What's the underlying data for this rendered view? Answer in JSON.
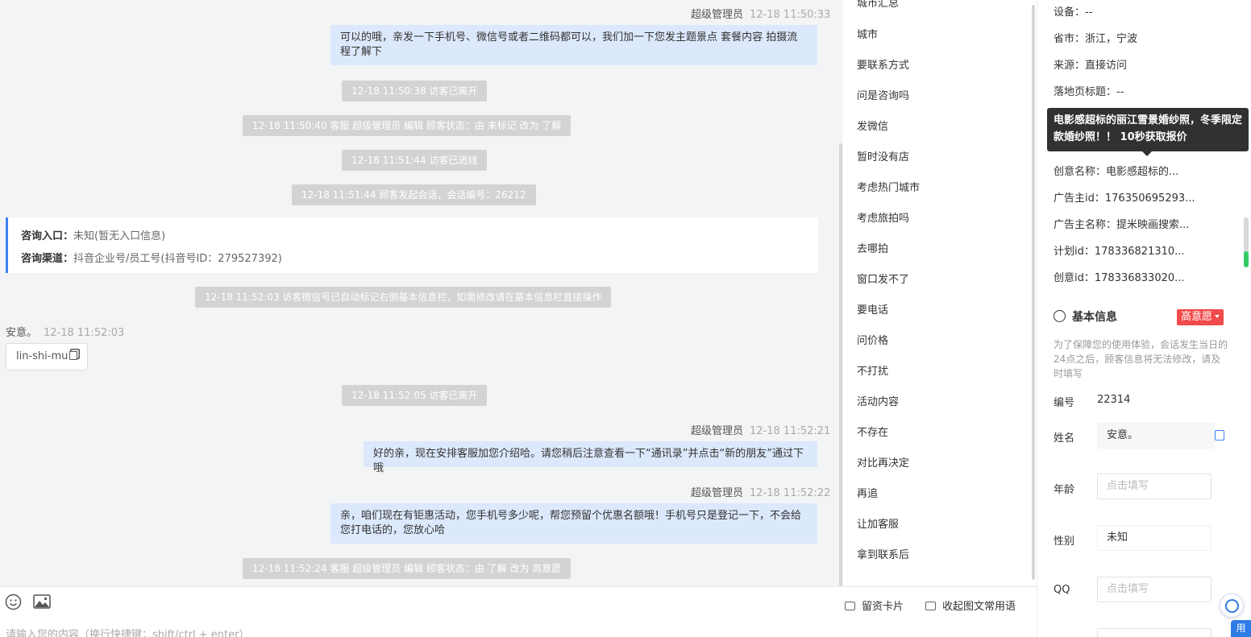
{
  "chat": {
    "messages": [
      {
        "kind": "out",
        "sender": "超级管理员",
        "time": "12-18 11:50:33",
        "text": "可以的哦，亲发一下手机号、微信号或者二维码都可以，我们加一下您发主题景点 套餐内容 拍摄流程了解下"
      },
      {
        "kind": "system",
        "text": "12-18 11:50:38 访客已离开"
      },
      {
        "kind": "system",
        "text": "12-18 11:50:40 客服 超级管理员 编辑 顾客状态：由 未标记 改为 了解"
      },
      {
        "kind": "system",
        "text": "12-18 11:51:44 访客已进线"
      },
      {
        "kind": "system",
        "text": "12-18 11:51:44 顾客发起会话，会话编号：26212"
      },
      {
        "kind": "info",
        "entry_label": "咨询入口：",
        "entry_value": "未知(暂无入口信息)",
        "channel_label": "咨询渠道：",
        "channel_value": "抖音企业号/员工号(抖音号ID：279527392)"
      },
      {
        "kind": "system",
        "text": "12-18 11:52:03 访客微信号已自动标记右侧基本信息栏，如需修改请在基本信息栏直接操作"
      },
      {
        "kind": "in",
        "sender": "安意。",
        "time": "12-18 11:52:03",
        "card_text": "lin-shi-mu"
      },
      {
        "kind": "system",
        "text": "12-18 11:52:05 访客已离开"
      },
      {
        "kind": "out",
        "sender": "超级管理员",
        "time": "12-18 11:52:21",
        "text": "好的亲，现在安排客服加您介绍哈。请您稍后注意查看一下“通讯录”并点击“新的朋友”通过下哦"
      },
      {
        "kind": "out",
        "sender": "超级管理员",
        "time": "12-18 11:52:22",
        "text": "亲，咱们现在有钜惠活动，您手机号多少呢，帮您预留个优惠名额哦！手机号只是登记一下，不会给您打电话的，您放心哈"
      },
      {
        "kind": "system",
        "text": "12-18 11:52:24 客服 超级管理员 编辑 顾客状态：由 了解 改为 高意愿"
      }
    ]
  },
  "composer": {
    "emoji_icon": "emoji-icon",
    "image_icon": "image-icon",
    "leave_card_label": "留资卡片",
    "collapse_phrases_label": "收起图文常用语",
    "placeholder": "请输入您的内容（换行快捷键：shift/ctrl + enter）"
  },
  "quick_replies": {
    "partial_top": "城市汇总",
    "items": [
      "城市",
      "要联系方式",
      "问是咨询吗",
      "发微信",
      "暂时没有店",
      "考虑热门城市",
      "考虑旅拍吗",
      "去哪拍",
      "窗口发不了",
      "要电话",
      "问价格",
      "不打扰",
      "活动内容",
      "不存在",
      "对比再决定",
      "再追",
      "让加客服",
      "拿到联系后"
    ]
  },
  "panel": {
    "source_info": [
      {
        "label": "设备：",
        "value": "--"
      },
      {
        "label": "省市：",
        "value": "浙江，宁波"
      },
      {
        "label": "来源：",
        "value": "直接访问"
      },
      {
        "label": "落地页标题：",
        "value": "--"
      },
      {
        "label": "创意名称：",
        "value": "电影感超标的..."
      },
      {
        "label": "广告主id：",
        "value": "176350695293..."
      },
      {
        "label": "广告主名称：",
        "value": "提米映画搜索..."
      },
      {
        "label": "计划id：",
        "value": "178336821310..."
      },
      {
        "label": "创意id：",
        "value": "178336833020..."
      }
    ],
    "tooltip": "电影感超标的丽江雪景婚纱照，冬季限定款婚纱照！！ 10秒获取报价",
    "basic_title": "基本信息",
    "status_badge": "高意愿",
    "notice": "为了保障您的使用体验，会话发生当日的24点之后，顾客信息将无法修改，请及时填写",
    "number_label": "编号",
    "number_value": "22314",
    "name_label": "姓名",
    "name_value": "安意。",
    "age_label": "年龄",
    "age_placeholder": "点击填写",
    "gender_label": "性别",
    "gender_value": "未知",
    "qq_label": "QQ",
    "qq_placeholder": "点击填写",
    "corner_tab": "用"
  }
}
